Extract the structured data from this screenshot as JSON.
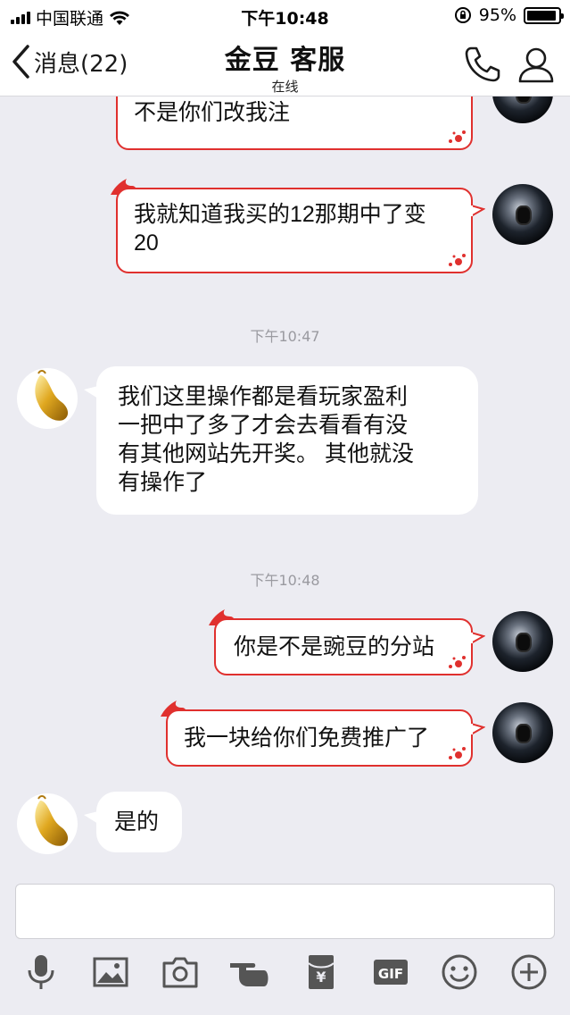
{
  "status_bar": {
    "carrier": "中国联通",
    "time": "下午10:48",
    "battery": "95%",
    "battery_level": 0.95
  },
  "nav": {
    "back_label": "消息(22)",
    "title": "金豆 客服",
    "subtitle": "在线"
  },
  "messages": [
    {
      "side": "out",
      "text": "不是你们改我注"
    },
    {
      "side": "out",
      "text": "我就知道我买的12那期中了变\n20"
    },
    {
      "type": "time",
      "text": "下午10:47"
    },
    {
      "side": "in",
      "text": "我们这里操作都是看玩家盈利\n一把中了多了才会去看看有没\n有其他网站先开奖。 其他就没\n有操作了"
    },
    {
      "type": "time",
      "text": "下午10:48"
    },
    {
      "side": "out",
      "text": "你是不是豌豆的分站"
    },
    {
      "side": "out",
      "text": "我一块给你们免费推广了"
    },
    {
      "side": "in",
      "text": "是的"
    }
  ],
  "input": {
    "value": ""
  },
  "toolbar": {
    "icons": [
      "microphone-icon",
      "image-icon",
      "camera-icon",
      "hand-point-icon",
      "red-packet-icon",
      "gif-icon",
      "emoji-icon",
      "plus-icon"
    ],
    "gif_label": "GIF",
    "red_packet_symbol": "¥"
  },
  "colors": {
    "accent_red": "#e0302e",
    "background": "#ececf2",
    "timestamp": "#9a9aa0"
  }
}
